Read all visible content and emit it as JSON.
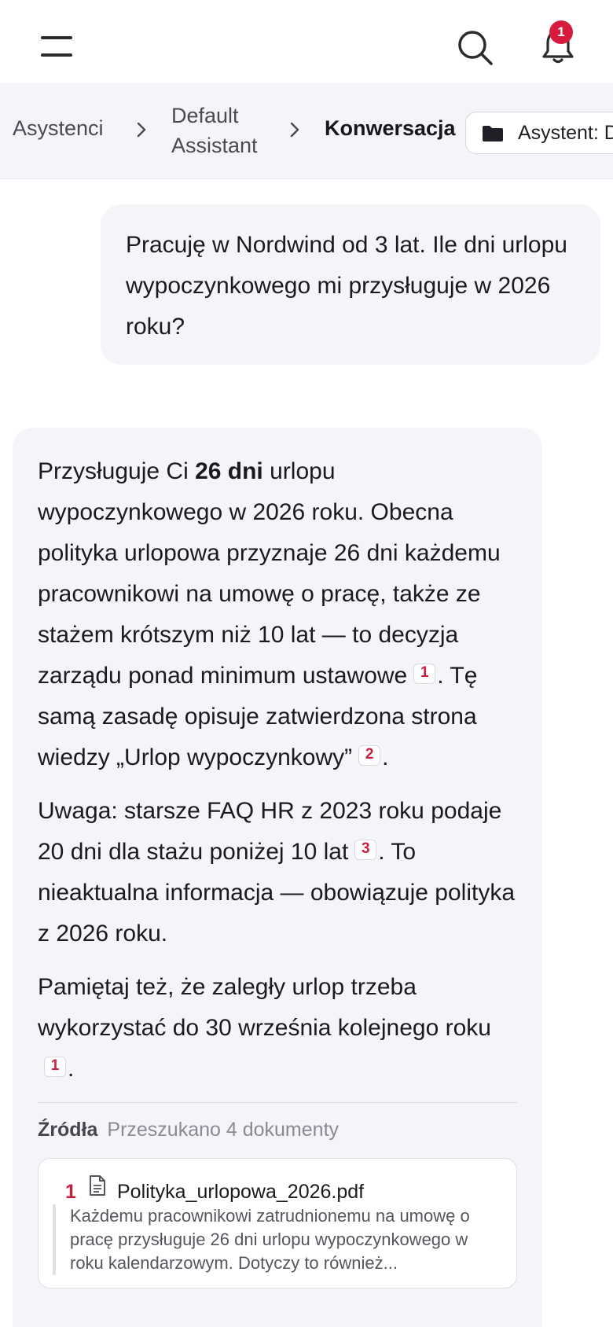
{
  "header": {
    "menu_icon": "hamburger-menu-icon",
    "search_icon": "search-icon",
    "bell_icon": "bell-icon",
    "notification_count": "1",
    "badge_color": "#d81b3c"
  },
  "breadcrumb": {
    "items": [
      "Asystenci",
      "Default Assistant",
      "Konwersacja"
    ],
    "assistant_chip": "Asystent: Default Assistant",
    "separator_icon": "chevron-right-icon",
    "folder_icon": "folder-icon"
  },
  "conversation": {
    "user_message": "Pracuję w Nordwind od 3 lat. Ile dni urlopu wypoczynkowego mi przysługuje w 2026 roku?",
    "assistant": {
      "p1_before": "Przysługuje Ci ",
      "p1_bold": "26 dni",
      "p1_mid": " urlopu wypoczynkowego w 2026 roku. Obecna polityka urlopowa przyznaje 26 dni każdemu pracownikowi na umowę o pracę, także ze stażem krótszym niż 10 lat — to decyzja zarządu ponad minimum ustawowe",
      "p1_cite_a": "1",
      "p1_after_a": ". Tę samą zasadę opisuje zatwierdzona strona wiedzy „Urlop wypoczynkowy”",
      "p1_cite_b": "2",
      "p1_end": ".",
      "p2_text": "Uwaga: starsze FAQ HR z 2023 roku podaje 20 dni dla stażu poniżej 10 lat",
      "p2_cite": "3",
      "p2_after": ". To nieaktualna informacja — obowiązuje polityka z 2026 roku.",
      "p3_text": "Pamiętaj też, że zaległy urlop trzeba wykorzystać do 30 września kolejnego roku",
      "p3_cite": "1",
      "p3_end": "."
    },
    "sources": {
      "title": "Źródła",
      "count_text": "Przeszukano 4 dokumenty",
      "items": [
        {
          "num": "1",
          "icon": "document-icon",
          "filename": "Polityka_urlopowa_2026.pdf",
          "excerpt": "Każdemu pracownikowi zatrudnionemu na umowę o pracę przysługuje 26 dni urlopu wypoczynkowego w roku kalendarzowym. Dotyczy to również..."
        }
      ]
    }
  },
  "colors": {
    "accent_red": "#c81e3d",
    "bubble_bg": "#f4f5f8"
  }
}
